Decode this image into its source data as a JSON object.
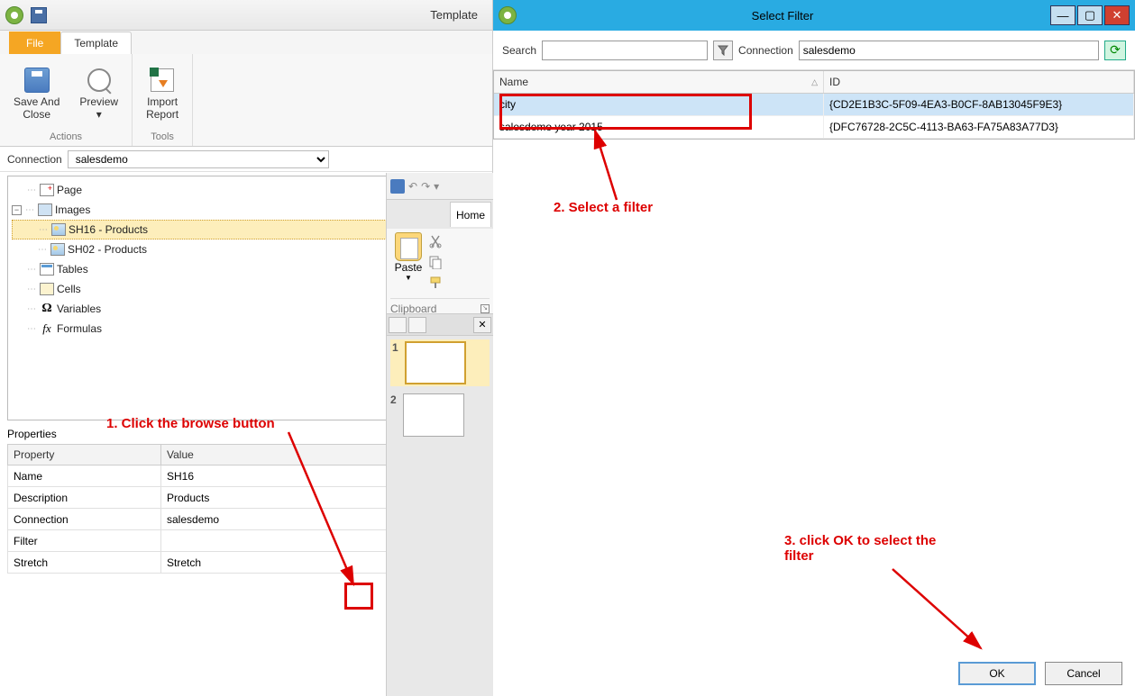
{
  "left": {
    "title": "Template",
    "tabs": {
      "file": "File",
      "template": "Template"
    },
    "ribbon": {
      "saveClose": "Save And\nClose",
      "preview": "Preview",
      "import": "Import\nReport",
      "groupActions": "Actions",
      "groupTools": "Tools"
    },
    "connection": {
      "label": "Connection",
      "value": "salesdemo"
    },
    "tree": {
      "page": "Page",
      "images": "Images",
      "sh16": "SH16 - Products",
      "sh02": "SH02 - Products",
      "tables": "Tables",
      "cells": "Cells",
      "variables": "Variables",
      "formulas": "Formulas"
    },
    "properties": {
      "title": "Properties",
      "headProperty": "Property",
      "headValue": "Value",
      "rows": {
        "name": {
          "k": "Name",
          "v": "SH16"
        },
        "desc": {
          "k": "Description",
          "v": "Products"
        },
        "conn": {
          "k": "Connection",
          "v": "salesdemo"
        },
        "filter": {
          "k": "Filter",
          "v": ""
        },
        "stretch": {
          "k": "Stretch",
          "v": "Stretch"
        }
      },
      "browse": "..."
    }
  },
  "mid": {
    "homeTab": "Home",
    "paste": "Paste",
    "clipboard": "Clipboard",
    "slide1": "1",
    "slide2": "2"
  },
  "dialog": {
    "title": "Select Filter",
    "searchLabel": "Search",
    "connLabel": "Connection",
    "connValue": "salesdemo",
    "cols": {
      "name": "Name",
      "id": "ID"
    },
    "rows": [
      {
        "name": "city",
        "id": "{CD2E1B3C-5F09-4EA3-B0CF-8AB13045F9E3}"
      },
      {
        "name": "salesdemo year 2015",
        "id": "{DFC76728-2C5C-4113-BA63-FA75A83A77D3}"
      }
    ],
    "ok": "OK",
    "cancel": "Cancel"
  },
  "annotations": {
    "a1": "1. Click the browse button",
    "a2": "2. Select a filter",
    "a3": "3. click OK to select the filter"
  }
}
